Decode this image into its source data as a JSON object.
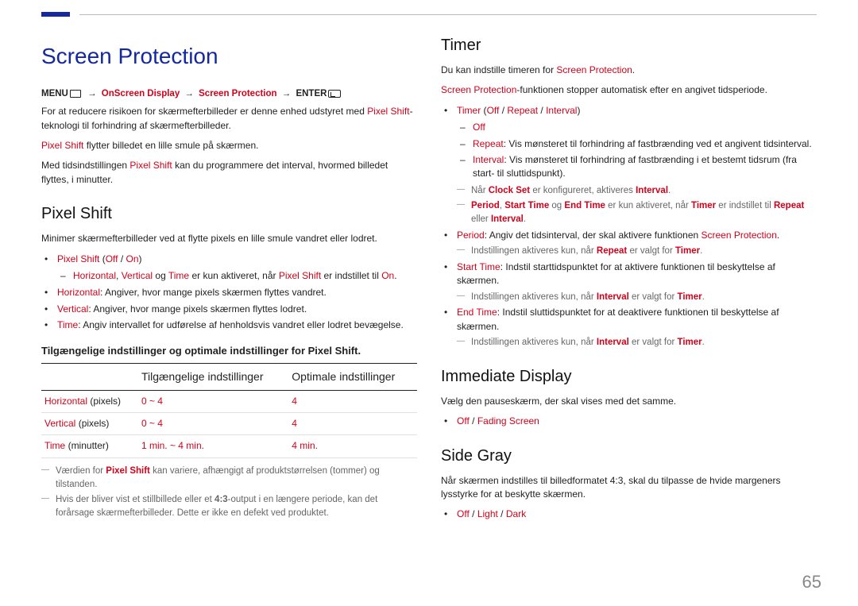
{
  "header": {
    "title": "Screen Protection",
    "path_menu": "MENU",
    "path_arrow": "→",
    "path_seg1": "OnScreen Display",
    "path_seg2": "Screen Protection",
    "path_enter": "ENTER"
  },
  "left": {
    "p1a": "For at reducere risikoen for skærmefterbilleder er denne enhed udstyret med ",
    "p1b": "Pixel Shift",
    "p1c": "-teknologi til forhindring af skærmefterbilleder.",
    "p2a": "Pixel Shift",
    "p2b": " flytter billedet en lille smule på skærmen.",
    "p3a": "Med tidsindstillingen ",
    "p3b": "Pixel Shift",
    "p3c": " kan du programmere det interval, hvormed billedet flyttes, i minutter.",
    "h2_pixel": "Pixel Shift",
    "p4": "Minimer skærmefterbilleder ved at flytte pixels en lille smule vandret eller lodret.",
    "b1_label": "Pixel Shift",
    "b1_off": "Off",
    "b1_on": "On",
    "b1_sep": " (",
    "b1_slash": " / ",
    "b1_close": ")",
    "d1a": "Horizontal",
    "d1b": "Vertical",
    "d1c": "Time",
    "d1_mid": " og ",
    "d1_mid2": ", ",
    "d1_tail1": " er kun aktiveret, når ",
    "d1_tail2": "Pixel Shift",
    "d1_tail3": " er indstillet til ",
    "d1_on": "On",
    "d1_dot": ".",
    "b2a": "Horizontal",
    "b2b": ": Angiver, hvor mange pixels skærmen flyttes vandret.",
    "b3a": "Vertical",
    "b3b": ": Angiver, hvor mange pixels skærmen flyttes lodret.",
    "b4a": "Time",
    "b4b": ": Angiv intervallet for udførelse af henholdsvis vandret eller lodret bevægelse.",
    "tbl_title": "Tilgængelige indstillinger og optimale indstillinger for Pixel Shift.",
    "th0": "",
    "th1": "Tilgængelige indstillinger",
    "th2": "Optimale indstillinger",
    "r1c0a": "Horizontal",
    "r1c0b": " (pixels)",
    "r1c1": "0 ~ 4",
    "r1c2": "4",
    "r2c0a": "Vertical",
    "r2c0b": " (pixels)",
    "r2c1": "0 ~ 4",
    "r2c2": "4",
    "r3c0a": "Time",
    "r3c0b": " (minutter)",
    "r3c1": "1 min. ~ 4 min.",
    "r3c2": "4 min.",
    "n1a": "Værdien for ",
    "n1b": "Pixel Shift",
    "n1c": " kan variere, afhængigt af produktstørrelsen (tommer) og tilstanden.",
    "n2a": "Hvis der bliver vist et stillbillede eller et ",
    "n2b": "4:3",
    "n2c": "-output i en længere periode, kan det forårsage skærmefterbilleder. Dette er ikke en defekt ved produktet."
  },
  "right": {
    "h2_timer": "Timer",
    "t_p1a": "Du kan indstille timeren for ",
    "t_p1b": "Screen Protection",
    "t_p1c": ".",
    "t_p2a": "Screen Protection",
    "t_p2b": "-funktionen stopper automatisk efter en angivet tidsperiode.",
    "tb_label": "Timer",
    "tb_open": " (",
    "tb_off": "Off",
    "tb_slash": " / ",
    "tb_repeat": "Repeat",
    "tb_interval": "Interval",
    "tb_close": ")",
    "td1": "Off",
    "td2a": "Repeat",
    "td2b": ": Vis mønsteret til forhindring af fastbrænding ved et angivent tidsinterval.",
    "td3a": "Interval",
    "td3b": ": Vis mønsteret til forhindring af fastbrænding i et bestemt tidsrum (fra start- til sluttidspunkt).",
    "tn1a": "Når ",
    "tn1b": "Clock Set",
    "tn1c": " er konfigureret, aktiveres ",
    "tn1d": "Interval",
    "tn1e": ".",
    "tn2a": "Period",
    "tn2b": "Start Time",
    "tn2c": "End Time",
    "tn2_mid1": ", ",
    "tn2_mid2": " og ",
    "tn2d": " er kun aktiveret, når ",
    "tn2e": "Timer",
    "tn2f": " er indstillet til ",
    "tn2g": "Repeat",
    "tn2h": " eller ",
    "tn2i": "Interval",
    "tn2j": ".",
    "pb_a": "Period",
    "pb_b": ": Angiv det tidsinterval, der skal aktivere funktionen ",
    "pb_c": "Screen Protection",
    "pb_d": ".",
    "pn_a": "Indstillingen aktiveres kun, når ",
    "pn_b": "Repeat",
    "pn_c": " er valgt for ",
    "pn_d": "Timer",
    "pn_e": ".",
    "st_a": "Start Time",
    "st_b": ": Indstil starttidspunktet for at aktivere funktionen til beskyttelse af skærmen.",
    "stn_a": "Indstillingen aktiveres kun, når ",
    "stn_b": "Interval",
    "stn_c": " er valgt for ",
    "stn_d": "Timer",
    "stn_e": ".",
    "et_a": "End Time",
    "et_b": ": Indstil sluttidspunktet for at deaktivere funktionen til beskyttelse af skærmen.",
    "etn_a": "Indstillingen aktiveres kun, når ",
    "etn_b": "Interval",
    "etn_c": " er valgt for ",
    "etn_d": "Timer",
    "etn_e": ".",
    "h2_imm": "Immediate Display",
    "imm_p": "Vælg den pauseskærm, der skal vises med det samme.",
    "imm_off": "Off",
    "imm_slash": " / ",
    "imm_fade": "Fading Screen",
    "h2_side": "Side Gray",
    "side_p": "Når skærmen indstilles til billedformatet 4:3, skal du tilpasse de hvide margeners lysstyrke for at beskytte skærmen.",
    "sg_off": "Off",
    "sg_light": "Light",
    "sg_dark": "Dark"
  },
  "page_num": "65"
}
